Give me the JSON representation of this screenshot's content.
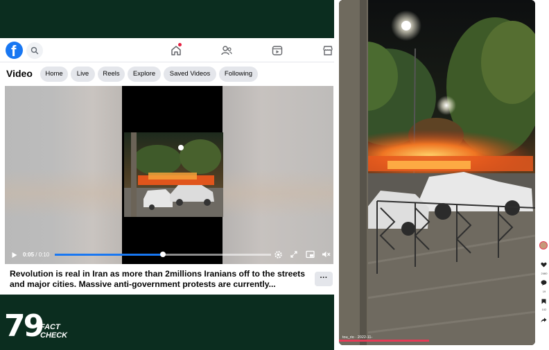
{
  "facebook": {
    "section_title": "Video",
    "tabs": [
      "Home",
      "Live",
      "Reels",
      "Explore",
      "Saved Videos",
      "Following"
    ],
    "player": {
      "current_time": "0:05",
      "duration": "0:10",
      "progress": 0.5
    },
    "caption": "Revolution is real in Iran as more than 2millions Iranians off to the streets and major cities. Massive anti-government protests are currently...",
    "more_label": "···"
  },
  "brand": {
    "number": "79",
    "line1": "FACT",
    "line2": "CHECK"
  },
  "tiktok": {
    "handle": "tou_rio",
    "date": "2022-11-",
    "likes": "2460",
    "comments": "19",
    "saves": "102"
  },
  "colors": {
    "panel_bg": "#0b2d1f",
    "fb_blue": "#1877f2",
    "chip_bg": "#e4e6eb"
  },
  "icons": [
    "facebook-logo-icon",
    "search-icon",
    "home-icon",
    "friends-icon",
    "video-icon",
    "marketplace-icon",
    "play-icon",
    "settings-icon",
    "expand-icon",
    "pip-icon",
    "volume-icon",
    "heart-icon",
    "comment-icon",
    "bookmark-icon",
    "share-icon"
  ]
}
